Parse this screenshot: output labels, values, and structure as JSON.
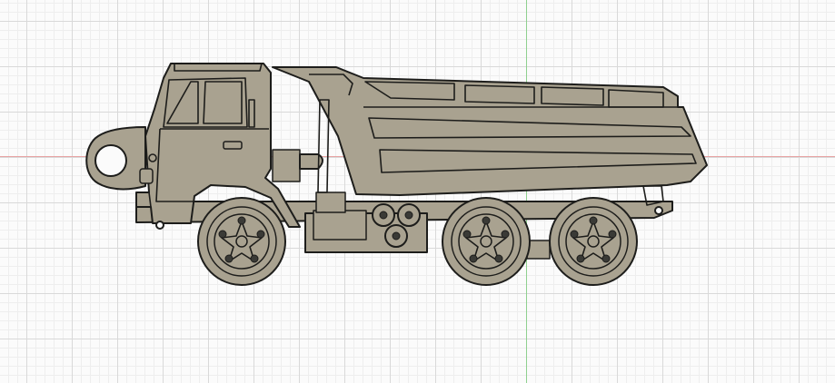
{
  "canvas": {
    "background": "#fbfbfb",
    "grid_major_color": "#d9d9d9",
    "grid_minor_color": "#eeeeee",
    "axis_x_color": "#e8a3a3",
    "axis_y_color": "#8fd08f"
  },
  "model": {
    "body_color": "#a9a290",
    "outline_color": "#1d1d1b",
    "wheel_icon": "wheel-icon",
    "keyring_icon": "keyring-hole-icon"
  }
}
